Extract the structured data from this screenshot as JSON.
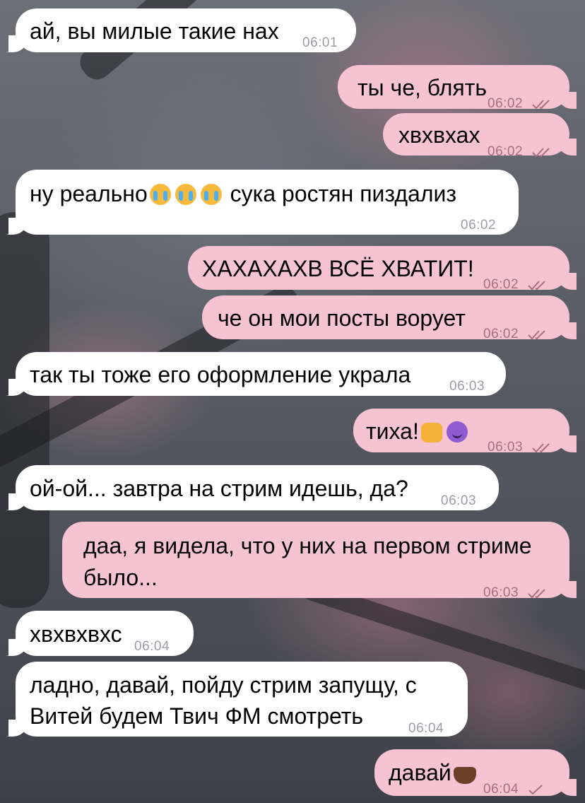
{
  "chat": {
    "messages": [
      {
        "dir": "in",
        "text": "ай, вы милые такие нах",
        "time": "06:01"
      },
      {
        "dir": "out",
        "text": "ты че, блять",
        "time": "06:02"
      },
      {
        "dir": "out",
        "text": "хвхвхах",
        "time": "06:02"
      },
      {
        "dir": "in",
        "text": "ну реально",
        "text2": "сука ростян пиздализ",
        "time": "06:02"
      },
      {
        "dir": "out",
        "text": "ХАХАХАХВ ВСЁ ХВАТИТ!",
        "time": "06:02"
      },
      {
        "dir": "out",
        "text": "че он мои посты ворует",
        "time": "06:02"
      },
      {
        "dir": "in",
        "text": "так ты тоже его оформление украла",
        "time": "06:03"
      },
      {
        "dir": "out",
        "text": "тиха!",
        "time": "06:03"
      },
      {
        "dir": "in",
        "text": "ой-ой... завтра на стрим идешь, да?",
        "time": "06:03"
      },
      {
        "dir": "out",
        "line1": "даа, я видела, что у них на первом стриме",
        "line2": "было...",
        "time": "06:03"
      },
      {
        "dir": "in",
        "text": "хвхвхвхс",
        "time": "06:04"
      },
      {
        "dir": "in",
        "line1": "ладно, давай, пойду стрим запущу, с",
        "line2": "Витей будем Твич ФМ смотреть",
        "time": "06:04"
      },
      {
        "dir": "out",
        "text": "давай",
        "time": "06:04"
      }
    ]
  },
  "colors": {
    "incoming_bubble": "#ffffff",
    "outgoing_bubble": "#f6c3d3",
    "incoming_time": "#9a9ea4",
    "outgoing_time": "#a86e7e"
  },
  "icons": {
    "read_receipt": "double-check-icon",
    "sent_receipt": "single-check-icon",
    "emoji_loudly_crying": "loudly-crying-face-emoji",
    "emoji_fist": "oncoming-fist-emoji",
    "emoji_devil": "smiling-imp-emoji",
    "emoji_heart_hands": "heart-hands-emoji"
  }
}
